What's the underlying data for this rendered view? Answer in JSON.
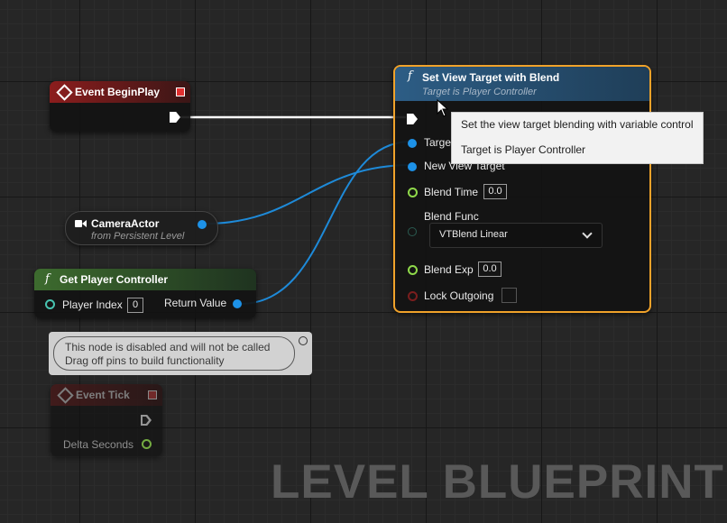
{
  "nodes": {
    "begin_play": {
      "title": "Event BeginPlay"
    },
    "camera_actor": {
      "title": "CameraActor",
      "subtitle": "from Persistent Level"
    },
    "get_player_controller": {
      "title": "Get Player Controller",
      "player_index_label": "Player Index",
      "player_index_value": "0",
      "return_value_label": "Return Value"
    },
    "set_view_target": {
      "title": "Set View Target with Blend",
      "subtitle": "Target is Player Controller",
      "target_label": "Target",
      "new_view_target_label": "New View Target",
      "blend_time_label": "Blend Time",
      "blend_time_value": "0.0",
      "blend_func_label": "Blend Func",
      "blend_func_value": "VTBlend Linear",
      "blend_exp_label": "Blend Exp",
      "blend_exp_value": "0.0",
      "lock_outgoing_label": "Lock Outgoing"
    },
    "disabled_comment": {
      "line1": "This node is disabled and will not be called",
      "line2": "Drag off pins to build functionality"
    },
    "event_tick": {
      "title": "Event Tick",
      "delta_seconds_label": "Delta Seconds"
    }
  },
  "tooltip": {
    "line1": "Set the view target blending with variable control",
    "line2": "Target is Player Controller"
  },
  "watermark": "LEVEL BLUEPRINT",
  "icons": {
    "event": "diamond-event-icon",
    "function": "function-f-icon",
    "camera": "camera-icon",
    "dropdown": "chevron-down-icon"
  },
  "colors": {
    "event_header": "#8c1d1d",
    "function_header_blue": "#2d5d85",
    "function_header_green": "#3d6b2e",
    "selection_outline": "#f0a22a",
    "object_pin": "#1d92e8",
    "float_pin": "#8fd94a"
  }
}
